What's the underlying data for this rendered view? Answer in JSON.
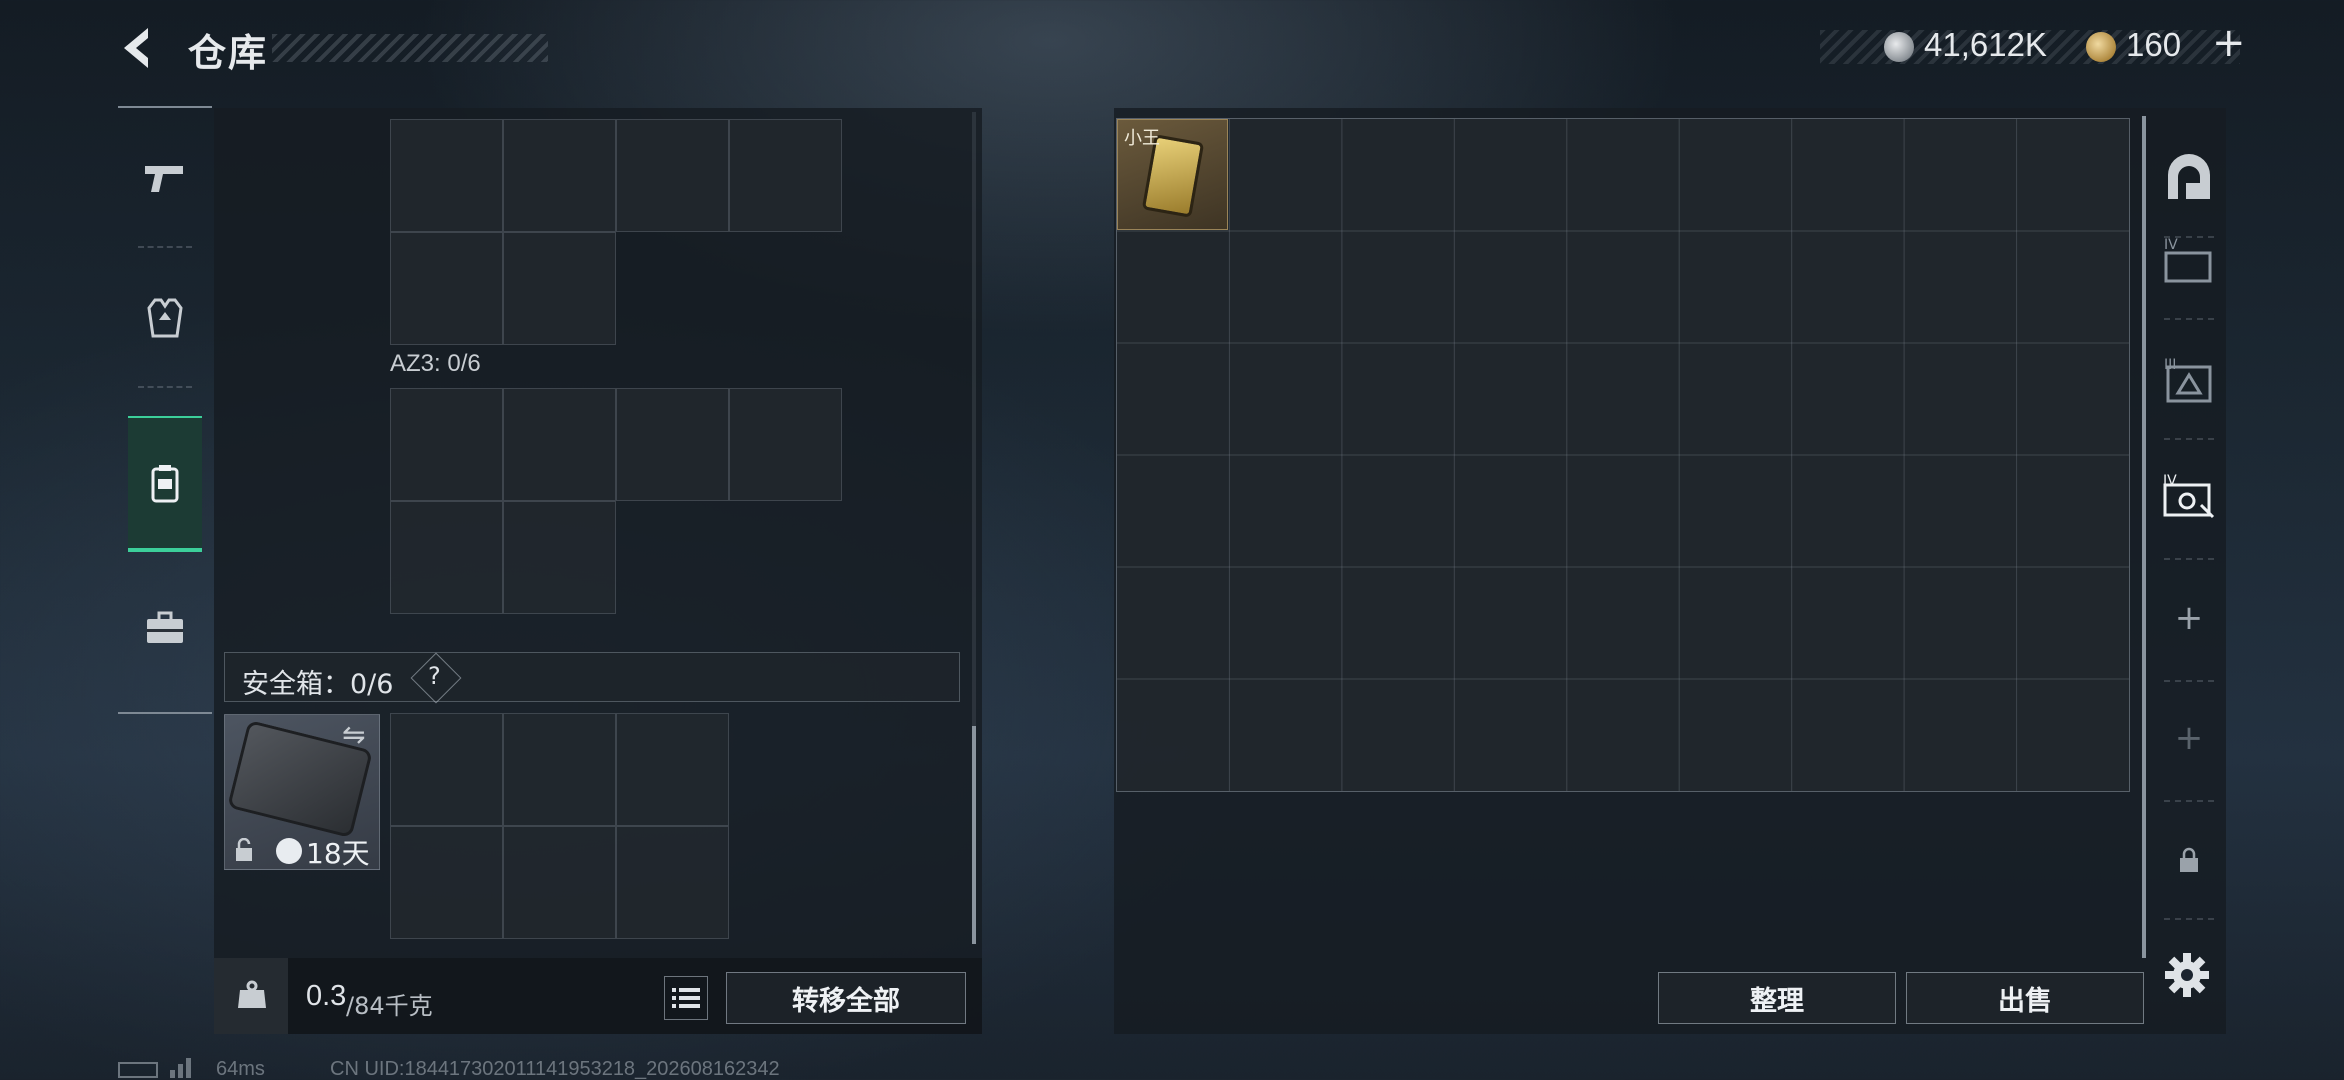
{
  "header": {
    "title": "仓库",
    "currency_silver": "41,612K",
    "currency_gold": "160",
    "topup_label": "+"
  },
  "left_rail": {
    "items": [
      {
        "name": "weapons",
        "icon": "pistol-icon"
      },
      {
        "name": "gear",
        "icon": "armor-vest-icon"
      },
      {
        "name": "backpack",
        "icon": "backpack-icon",
        "active": true
      },
      {
        "name": "safe-case",
        "icon": "briefcase-icon"
      }
    ]
  },
  "left_panel": {
    "az3_label": "AZ3: 0/6",
    "safe_box_label": "安全箱：0/6",
    "help_label": "?",
    "case_timer": "18天"
  },
  "footer": {
    "weight_value": "0.3",
    "weight_max": "/84千克",
    "transfer_all_label": "转移全部"
  },
  "stash": {
    "item_label": "小王",
    "sort_label": "整理",
    "sell_label": "出售"
  },
  "side_rail": {
    "items": [
      {
        "name": "warehouse-main",
        "icon": "arch-icon"
      },
      {
        "name": "container-1",
        "icon": "container-icon",
        "tag": "IV"
      },
      {
        "name": "container-2",
        "icon": "container-icon",
        "tag": "III"
      },
      {
        "name": "container-3",
        "icon": "container-key-icon",
        "tag": "IV"
      },
      {
        "name": "add-1",
        "icon": "plus-icon",
        "label": "+"
      },
      {
        "name": "add-2",
        "icon": "plus-icon",
        "label": "+"
      },
      {
        "name": "locked",
        "icon": "lock-icon"
      }
    ]
  },
  "status": {
    "ping": "64ms",
    "uid": "CN UID:18441730201114195321​8_202608162342"
  },
  "colors": {
    "accent": "#3ccf9a",
    "gold_item": "#9a8458"
  }
}
